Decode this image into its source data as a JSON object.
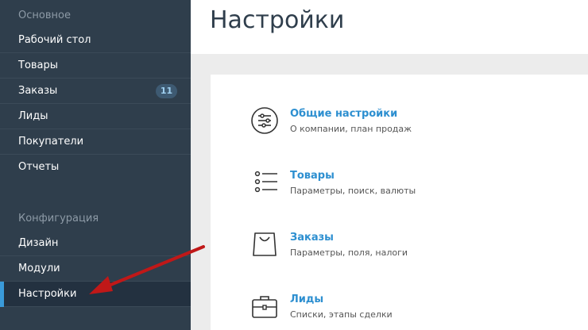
{
  "sidebar": {
    "section_main": "Основное",
    "section_config": "Конфигурация",
    "items": [
      {
        "label": "Рабочий стол"
      },
      {
        "label": "Товары"
      },
      {
        "label": "Заказы",
        "badge": "11"
      },
      {
        "label": "Лиды"
      },
      {
        "label": "Покупатели"
      },
      {
        "label": "Отчеты"
      }
    ],
    "config_items": [
      {
        "label": "Дизайн"
      },
      {
        "label": "Модули"
      },
      {
        "label": "Настройки",
        "active": true
      }
    ]
  },
  "header": {
    "title": "Настройки"
  },
  "settings": [
    {
      "title": "Общие настройки",
      "desc": "О компании, план продаж",
      "icon": "sliders-icon"
    },
    {
      "title": "Товары",
      "desc": "Параметры, поиск, валюты",
      "icon": "list-icon"
    },
    {
      "title": "Заказы",
      "desc": "Параметры, поля, налоги",
      "icon": "shopping-bag-icon"
    },
    {
      "title": "Лиды",
      "desc": "Списки, этапы сделки",
      "icon": "briefcase-icon"
    }
  ],
  "colors": {
    "sidebar_bg": "#2f3e4c",
    "active_accent": "#3a9ad9",
    "link": "#2d8fd0",
    "arrow": "#c01818"
  }
}
